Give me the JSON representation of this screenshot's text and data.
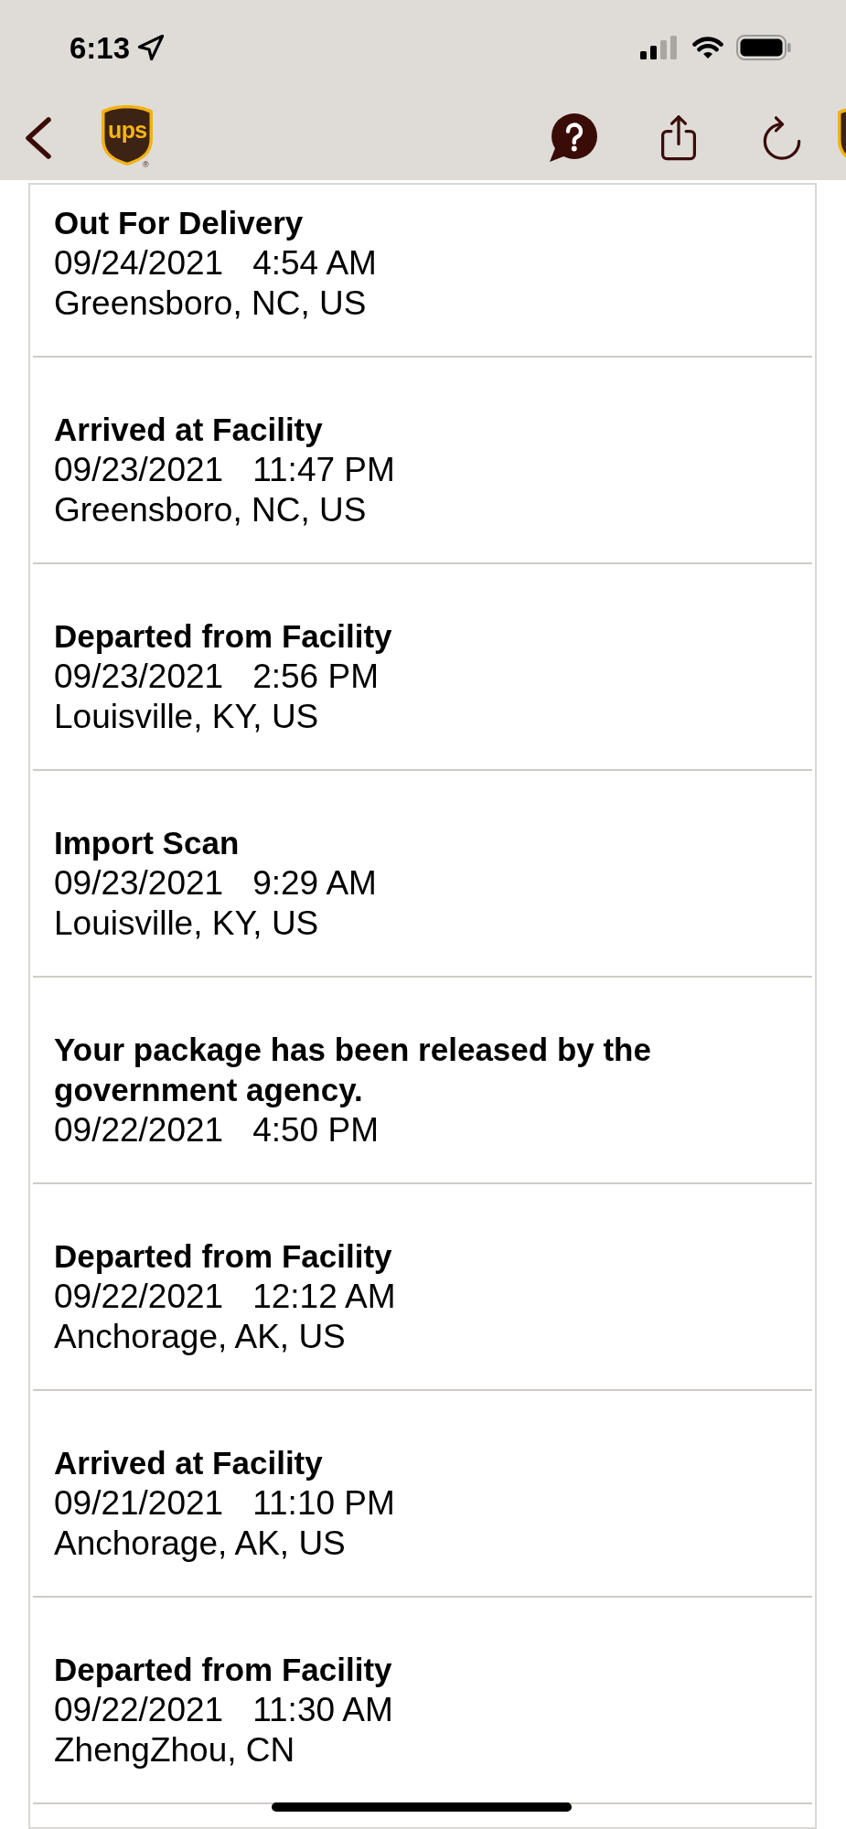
{
  "status_bar": {
    "time": "6:13"
  },
  "nav_bar": {
    "logo_text": "ups",
    "logo_mark": "®"
  },
  "events": [
    {
      "status": "Out For Delivery",
      "date": "09/24/2021",
      "time": "4:54 AM",
      "location": "Greensboro, NC, US"
    },
    {
      "status": "Arrived at Facility",
      "date": "09/23/2021",
      "time": "11:47 PM",
      "location": "Greensboro, NC, US"
    },
    {
      "status": "Departed from Facility",
      "date": "09/23/2021",
      "time": "2:56 PM",
      "location": "Louisville, KY, US"
    },
    {
      "status": "Import Scan",
      "date": "09/23/2021",
      "time": "9:29 AM",
      "location": "Louisville, KY, US"
    },
    {
      "status": "Your package has been released by the government agency.",
      "date": "09/22/2021",
      "time": "4:50 PM"
    },
    {
      "status": "Departed from Facility",
      "date": "09/22/2021",
      "time": "12:12 AM",
      "location": "Anchorage, AK, US"
    },
    {
      "status": "Arrived at Facility",
      "date": "09/21/2021",
      "time": "11:10 PM",
      "location": "Anchorage, AK, US"
    },
    {
      "status": "Departed from Facility",
      "date": "09/22/2021",
      "time": "11:30 AM",
      "location": "ZhengZhou, CN"
    }
  ]
}
